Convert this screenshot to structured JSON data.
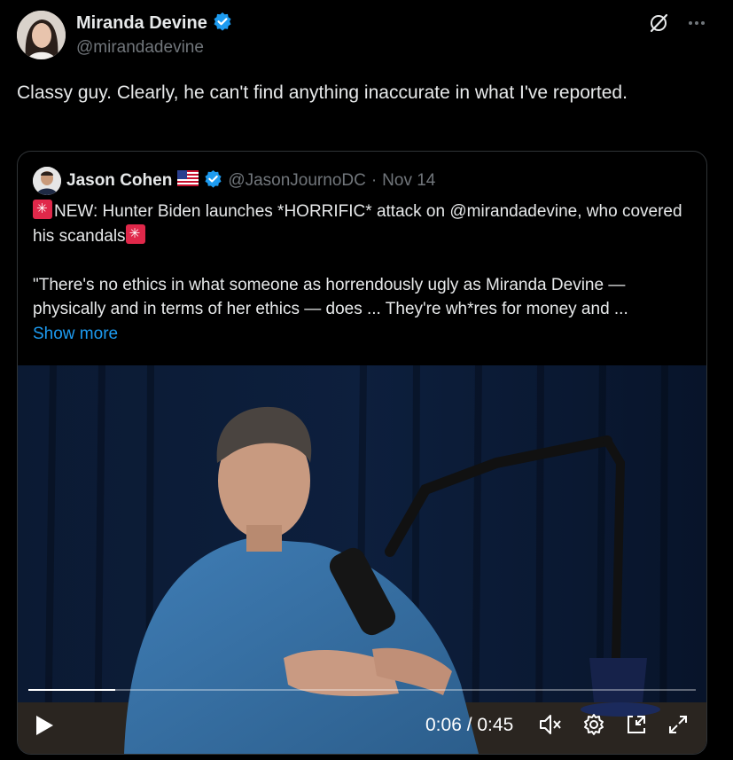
{
  "tweet": {
    "author_name": "Miranda Devine",
    "author_handle": "@mirandadevine",
    "text": "Classy guy. Clearly, he can't find anything inaccurate in what I've reported."
  },
  "quoted": {
    "author_name": "Jason Cohen",
    "author_handle": "@JasonJournoDC",
    "separator": "·",
    "date": "Nov 14",
    "line1": "NEW: Hunter Biden launches *HORRIFIC* attack on @mirandadevine, who covered his scandals",
    "line2": "\"There's no ethics in what someone as horrendously ugly as Miranda Devine — physically and in terms of her ethics — does ... They're wh*res for money and ...",
    "show_more": "Show more"
  },
  "video": {
    "time": "0:06 / 0:45",
    "progress": 0.13
  },
  "colors": {
    "accent": "#1d9bf0",
    "background": "#000000",
    "text": "#e7e9ea",
    "muted": "#71767b"
  }
}
